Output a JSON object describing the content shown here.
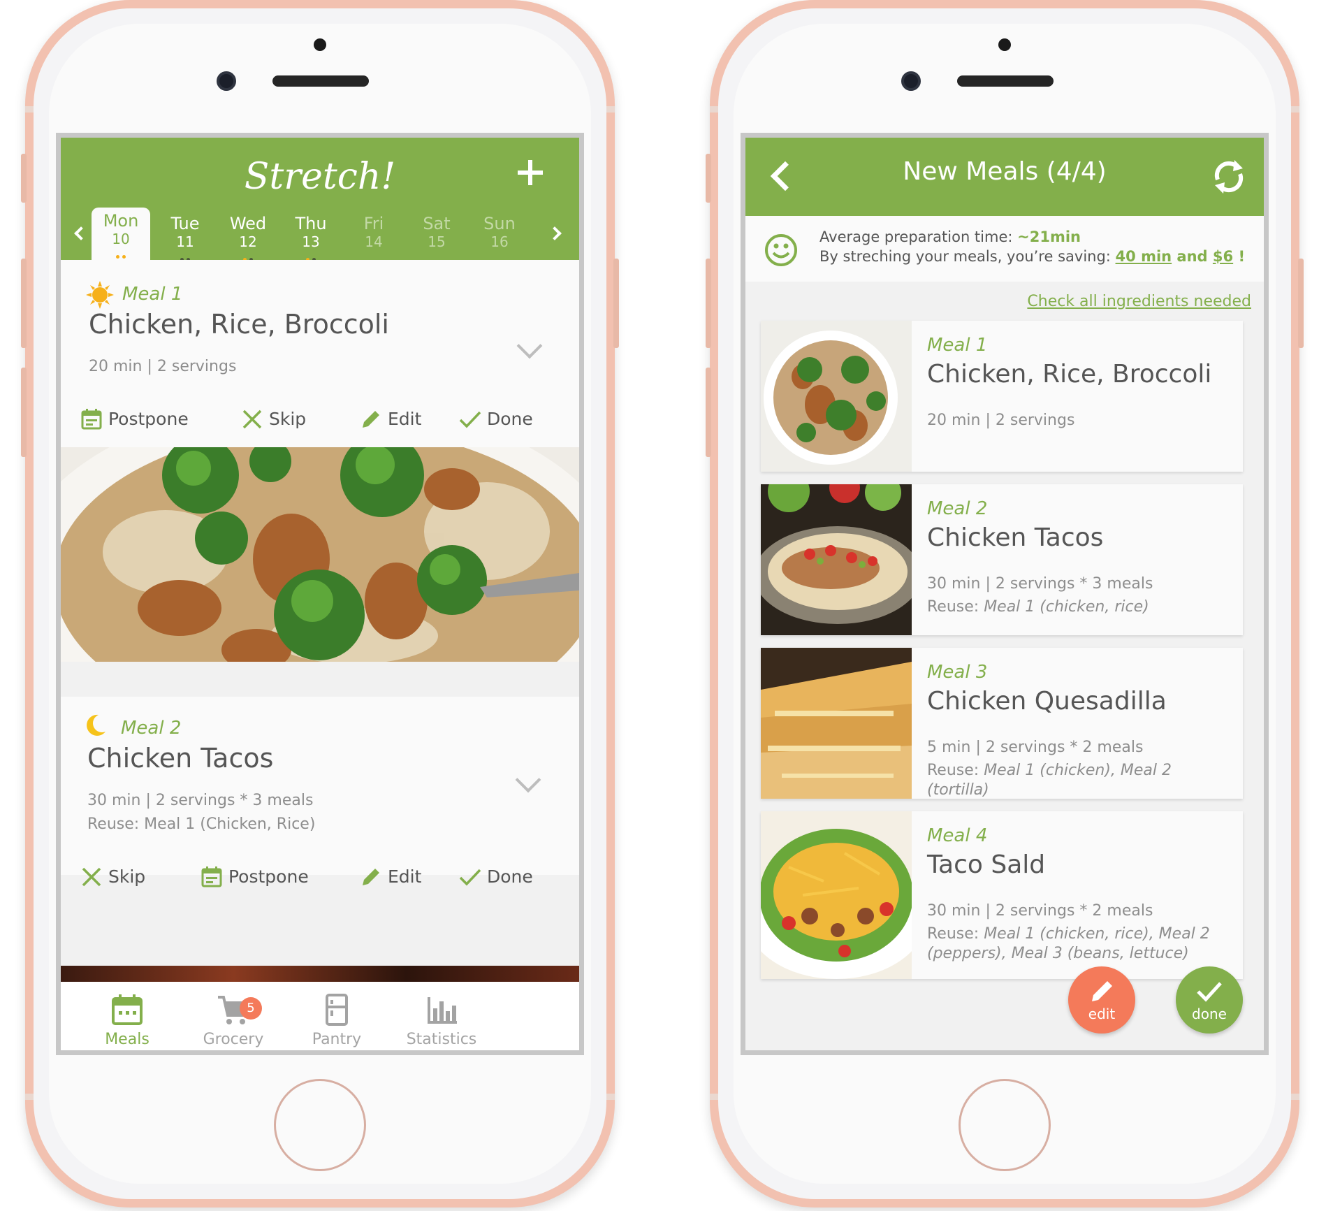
{
  "colors": {
    "accent": "#83af4b",
    "fab_edit": "#f47a5a",
    "badge": "#f47a5a",
    "phone_rose_gold": "#f2c1b0"
  },
  "left_screen": {
    "app_title": "Stretch!",
    "add_icon": "plus-icon",
    "days": [
      {
        "name": "Mon",
        "num": "10",
        "active": true
      },
      {
        "name": "Tue",
        "num": "11"
      },
      {
        "name": "Wed",
        "num": "12"
      },
      {
        "name": "Thu",
        "num": "13"
      },
      {
        "name": "Fri",
        "num": "14"
      },
      {
        "name": "Sat",
        "num": "15"
      },
      {
        "name": "Sun",
        "num": "16"
      }
    ],
    "meals": [
      {
        "tag": "Meal 1",
        "icon": "sun-icon",
        "title": "Chicken, Rice, Broccoli",
        "meta": "20 min | 2 servings",
        "actions": {
          "postpone": "Postpone",
          "skip": "Skip",
          "edit": "Edit",
          "done": "Done"
        }
      },
      {
        "tag": "Meal 2",
        "icon": "moon-icon",
        "title": "Chicken Tacos",
        "meta": "30 min | 2 servings * 3 meals",
        "reuse": "Reuse: Meal 1 (Chicken, Rice)",
        "actions": {
          "skip": "Skip",
          "postpone": "Postpone",
          "edit": "Edit",
          "done": "Done"
        }
      }
    ],
    "tabbar": {
      "meals": "Meals",
      "grocery": "Grocery",
      "grocery_badge": "5",
      "pantry": "Pantry",
      "statistics": "Statistics"
    }
  },
  "right_screen": {
    "title": "New Meals (4/4)",
    "summary": {
      "prep_label": "Average preparation time: ",
      "prep_value": "~21min",
      "saving_label": "By streching your meals, you’re saving: ",
      "saving_time": "40 min",
      "saving_and": " and ",
      "saving_money": "$6",
      "saving_end": " !"
    },
    "check_link": "Check all ingredients needed",
    "meals": [
      {
        "tag": "Meal 1",
        "name": "Chicken, Rice, Broccoli",
        "meta": "20 min | 2 servings",
        "reuse_label": "",
        "reuse_value": ""
      },
      {
        "tag": "Meal 2",
        "name": "Chicken Tacos",
        "meta": "30 min | 2 servings * 3 meals",
        "reuse_label": "Reuse: ",
        "reuse_value": "Meal 1 (chicken, rice)"
      },
      {
        "tag": "Meal 3",
        "name": "Chicken Quesadilla",
        "meta": "5 min | 2 servings * 2 meals",
        "reuse_label": "Reuse: ",
        "reuse_value": "Meal 1 (chicken), Meal 2 (tortilla)"
      },
      {
        "tag": "Meal 4",
        "name": "Taco Sald",
        "meta": "30 min | 2 servings * 2 meals",
        "reuse_label": "Reuse: ",
        "reuse_value": "Meal 1 (chicken, rice), Meal 2 (peppers), Meal 3 (beans, lettuce)"
      }
    ],
    "fab_edit": "edit",
    "fab_done": "done"
  }
}
